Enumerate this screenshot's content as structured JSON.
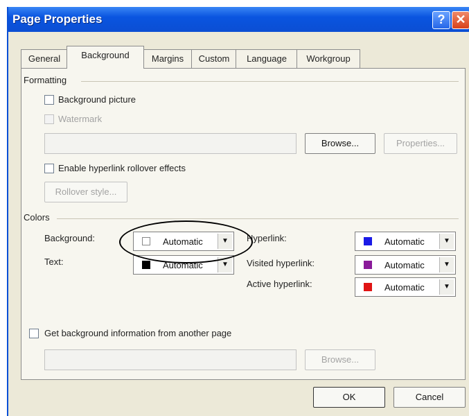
{
  "window": {
    "title": "Page Properties"
  },
  "titlebar": {
    "help_glyph": "?",
    "close_glyph": "✕"
  },
  "tabs": [
    {
      "label": "General"
    },
    {
      "label": "Background"
    },
    {
      "label": "Margins"
    },
    {
      "label": "Custom"
    },
    {
      "label": "Language"
    },
    {
      "label": "Workgroup"
    }
  ],
  "formatting": {
    "title": "Formatting",
    "background_picture": {
      "label": "Background picture",
      "checked": false
    },
    "watermark": {
      "label": "Watermark",
      "checked": false,
      "disabled": true
    },
    "picture_path": "",
    "browse_label": "Browse...",
    "properties_label": "Properties...",
    "rollover_effects": {
      "label": "Enable hyperlink rollover effects",
      "checked": false
    },
    "rollover_style_label": "Rollover style..."
  },
  "colors": {
    "title": "Colors",
    "background": {
      "label": "Background:",
      "value": "Automatic",
      "swatch": "#ffffff"
    },
    "text": {
      "label": "Text:",
      "value": "Automatic",
      "swatch": "#000000"
    },
    "hyperlink": {
      "label": "Hyperlink:",
      "value": "Automatic",
      "swatch": "#1a1ae6"
    },
    "visited_hyperlink": {
      "label": "Visited hyperlink:",
      "value": "Automatic",
      "swatch": "#8a1a9a"
    },
    "active_hyperlink": {
      "label": "Active hyperlink:",
      "value": "Automatic",
      "swatch": "#e01414"
    }
  },
  "get_background": {
    "label": "Get background information from another page",
    "checked": false,
    "path": "",
    "browse_label": "Browse..."
  },
  "footer": {
    "ok_label": "OK",
    "cancel_label": "Cancel"
  }
}
